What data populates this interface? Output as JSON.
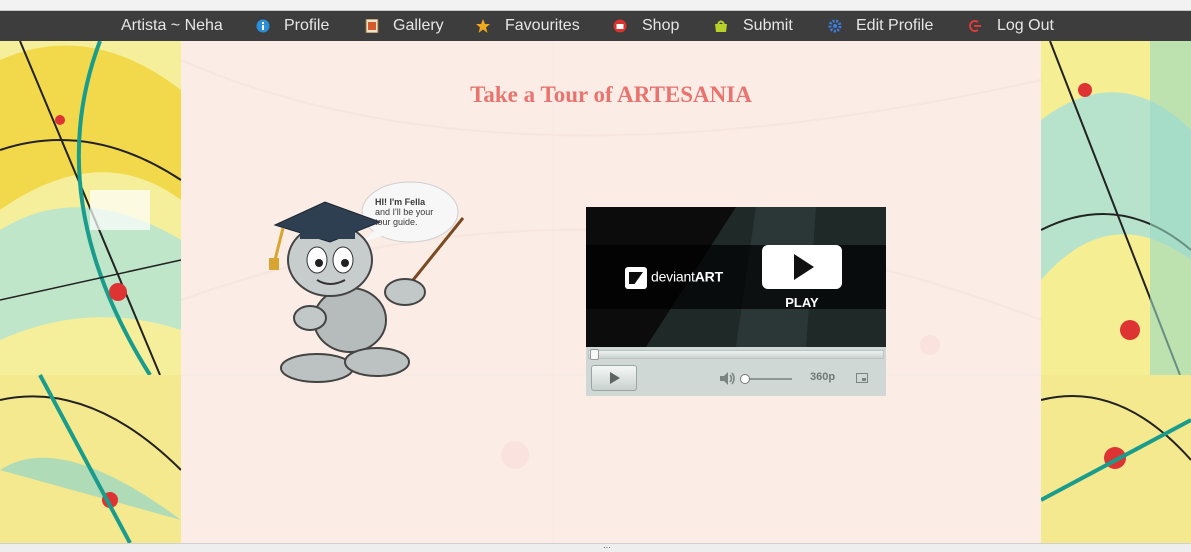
{
  "nav": {
    "items": [
      {
        "label": "Artista ~ Neha",
        "icon": "none"
      },
      {
        "label": "Profile",
        "icon": "info-icon"
      },
      {
        "label": "Gallery",
        "icon": "gallery-icon"
      },
      {
        "label": "Favourites",
        "icon": "star-icon"
      },
      {
        "label": "Shop",
        "icon": "shop-icon"
      },
      {
        "label": "Submit",
        "icon": "submit-icon"
      },
      {
        "label": "Edit Profile",
        "icon": "gear-icon"
      },
      {
        "label": "Log Out",
        "icon": "logout-icon"
      }
    ]
  },
  "main": {
    "title": "Take a Tour of ARTESANIA",
    "guide": {
      "bubble_lines": [
        "HI! I'm Fella",
        "and I'll be your",
        "tour guide."
      ]
    },
    "player": {
      "brand_light": "deviant",
      "brand_bold": "ART",
      "play_label": "PLAY",
      "quality": "360p"
    }
  },
  "colors": {
    "nav_bg": "#3d3d3d",
    "title": "#e9736f",
    "panel": "#fcecea"
  }
}
